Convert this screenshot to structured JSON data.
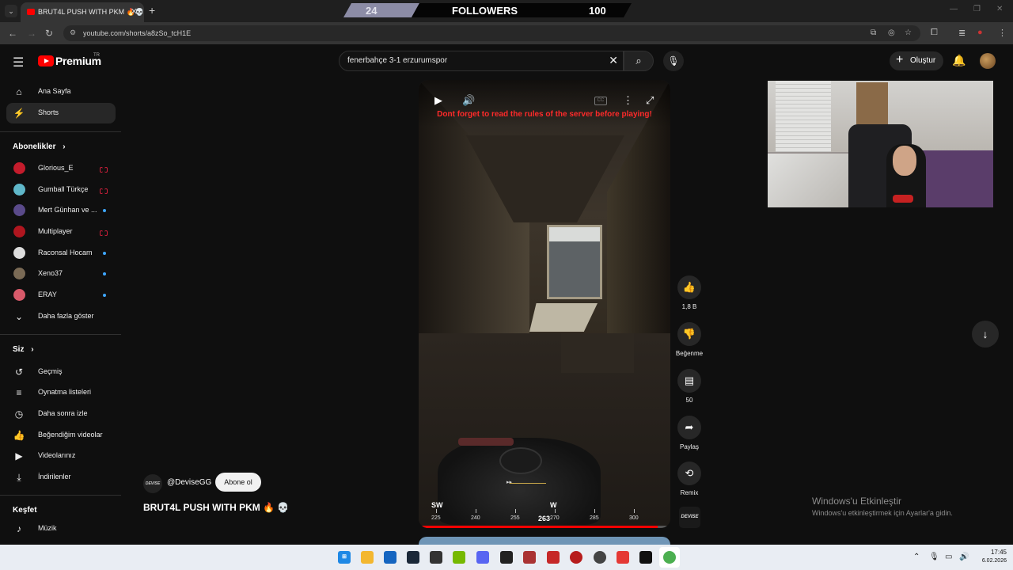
{
  "browser": {
    "tab_title": "BRUT4L PUSH WITH PKM 🔥💀",
    "url": "youtube.com/shorts/a8zSo_tcH1E"
  },
  "overlay": {
    "left_count": "24",
    "label": "FOLLOWERS",
    "right_count": "100"
  },
  "header": {
    "logo_text": "Premium",
    "country": "TR",
    "search_value": "fenerbahçe 3-1 erzurumspor",
    "create_label": "Oluştur"
  },
  "sidebar": {
    "main": [
      {
        "label": "Ana Sayfa",
        "icon": "home-icon"
      },
      {
        "label": "Shorts",
        "icon": "shorts-icon"
      }
    ],
    "subscriptions_title": "Abonelikler",
    "subscriptions": [
      {
        "label": "Glorious_E",
        "status": "live",
        "color": "#c41c2c"
      },
      {
        "label": "Gumball Türkçe",
        "status": "live",
        "color": "#5fb7c9"
      },
      {
        "label": "Mert Günhan ve ...",
        "status": "new",
        "color": "#5a4a8a"
      },
      {
        "label": "Multiplayer",
        "status": "live",
        "color": "#b0161f"
      },
      {
        "label": "Raconsal Hocam",
        "status": "new",
        "color": "#ffffff"
      },
      {
        "label": "Xeno37",
        "status": "new",
        "color": "#7a6a55"
      },
      {
        "label": "ERAY",
        "status": "new",
        "color": "#d85a6a"
      }
    ],
    "show_more": "Daha fazla göster",
    "you_title": "Siz",
    "you_items": [
      {
        "label": "Geçmiş",
        "icon": "history-icon"
      },
      {
        "label": "Oynatma listeleri",
        "icon": "playlist-icon"
      },
      {
        "label": "Daha sonra izle",
        "icon": "watch-later-icon"
      },
      {
        "label": "Beğendiğim videolar",
        "icon": "like-icon"
      },
      {
        "label": "Videolarınız",
        "icon": "video-icon"
      },
      {
        "label": "İndirilenler",
        "icon": "download-icon"
      }
    ],
    "explore_title": "Keşfet",
    "explore_items": [
      {
        "label": "Müzik",
        "icon": "music-icon"
      }
    ]
  },
  "video": {
    "notice": "Dont forget to read the rules of the server before playing!",
    "compass": {
      "heading": "263",
      "labels": [
        {
          "text": "SW",
          "value": "225"
        },
        {
          "text": "",
          "value": "240"
        },
        {
          "text": "",
          "value": "255"
        },
        {
          "text": "W",
          "value": "270"
        },
        {
          "text": "",
          "value": "285"
        },
        {
          "text": "",
          "value": "300"
        }
      ]
    },
    "progress": 0.96
  },
  "actions": {
    "likes": "1,8 B",
    "dislike": "Beğenme",
    "comments": "50",
    "share": "Paylaş",
    "remix": "Remix"
  },
  "channel": {
    "name": "@DeviseGG",
    "subscribe": "Abone ol",
    "logo": "DEVISE",
    "title": "BRUT4L PUSH WITH PKM 🔥 💀"
  },
  "windows": {
    "activate_title": "Windows'u Etkinleştir",
    "activate_sub": "Windows'u etkinleştirmek için Ayarlar'a gidin.",
    "time": "17:45",
    "date": "6.02.2026"
  }
}
